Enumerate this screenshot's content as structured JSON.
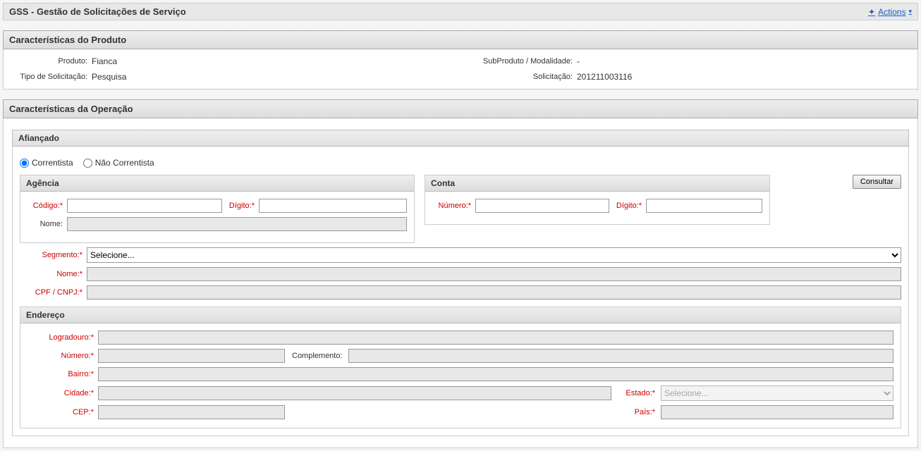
{
  "header": {
    "title": "GSS - Gestão de Solicitações de Serviço",
    "actions_label": "Actions"
  },
  "produto_panel": {
    "title": "Características do Produto",
    "labels": {
      "produto": "Produto:",
      "tipo_solicitacao": "Tipo de Solicitação:",
      "subproduto": "SubProduto / Modalidade:",
      "solicitacao": "Solicitação:"
    },
    "values": {
      "produto": "Fianca",
      "tipo_solicitacao": "Pesquisa",
      "subproduto": "-",
      "solicitacao": "201211003116"
    }
  },
  "operacao_panel": {
    "title": "Características da Operação",
    "afiancado": {
      "title": "Afiançado",
      "radio_correntista": "Correntista",
      "radio_nao_correntista": "Não Correntista",
      "agencia_title": "Agência",
      "conta_title": "Conta",
      "labels": {
        "codigo": "Código:",
        "digito": "Dígito:",
        "nome_ag": "Nome:",
        "numero": "Número:",
        "consultar": "Consultar",
        "segmento": "Segmento:",
        "nome": "Nome:",
        "cpfcnpj": "CPF / CNPJ:"
      },
      "segmento_value": "Selecione..."
    },
    "endereco": {
      "title": "Endereço",
      "labels": {
        "logradouro": "Logradouro:",
        "numero": "Número:",
        "complemento": "Complemento:",
        "bairro": "Bairro:",
        "cidade": "Cidade:",
        "estado": "Estado:",
        "cep": "CEP:",
        "pais": "País:"
      },
      "estado_value": "Selecione..."
    }
  }
}
